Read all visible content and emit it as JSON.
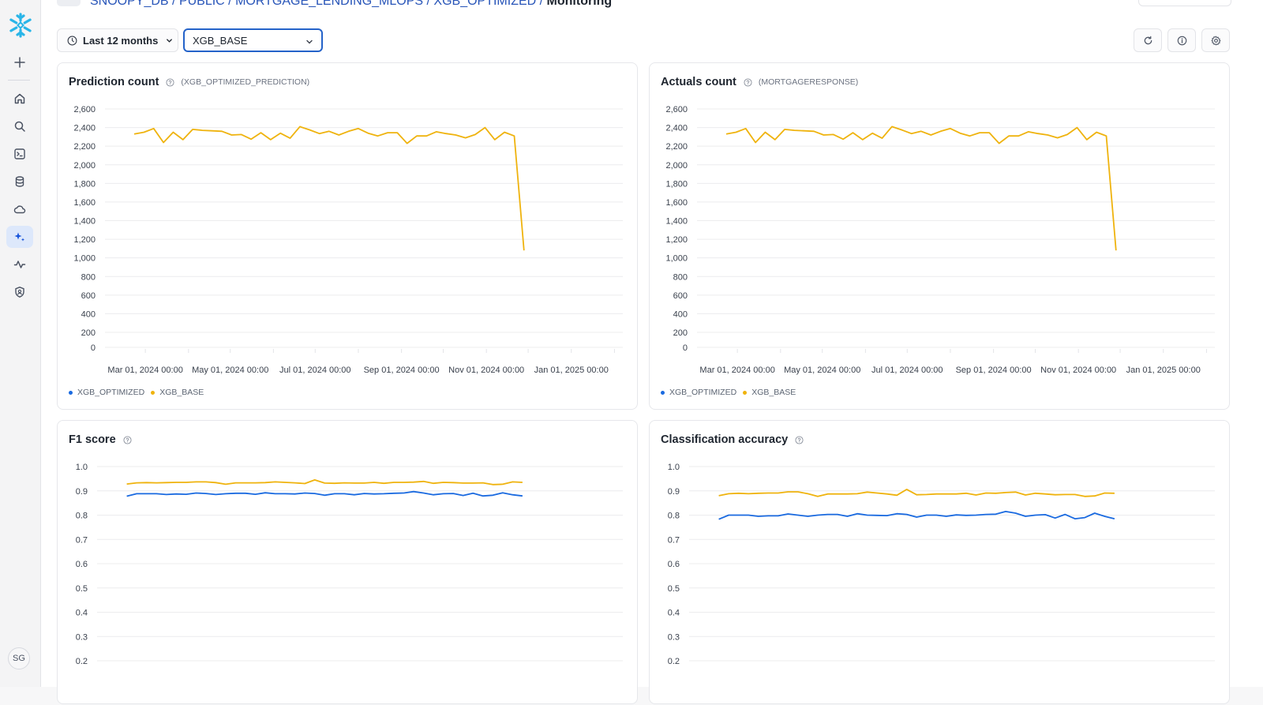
{
  "breadcrumb": {
    "items": [
      "SNOOPY_DB",
      "PUBLIC",
      "MORTGAGE_LENDING_MLOPS",
      "XGB_OPTIMIZED"
    ],
    "current": "Monitoring",
    "separator": " / "
  },
  "sidebar": {
    "items": [
      {
        "name": "create",
        "icon": "plus-icon"
      },
      {
        "name": "home",
        "icon": "home-icon"
      },
      {
        "name": "search",
        "icon": "search-icon"
      },
      {
        "name": "projects",
        "icon": "terminal-icon"
      },
      {
        "name": "data",
        "icon": "database-icon"
      },
      {
        "name": "data-products",
        "icon": "cloud-icon"
      },
      {
        "name": "ai-ml",
        "icon": "sparkle-icon",
        "active": true
      },
      {
        "name": "monitoring",
        "icon": "activity-icon"
      },
      {
        "name": "admin",
        "icon": "shield-icon"
      }
    ],
    "avatar_initials": "SG"
  },
  "toolbar": {
    "time_range_label": "Last 12 months",
    "model_select_value": "XGB_BASE",
    "refresh_icon": "refresh-icon",
    "info_icon": "info-icon",
    "settings_icon": "gear-icon"
  },
  "colors": {
    "xgb_optimized": "#1a6ae0",
    "xgb_base": "#efb30e",
    "accent": "#2563c9",
    "grid": "#ececee"
  },
  "legend": [
    {
      "name": "XGB_OPTIMIZED",
      "color": "#1a6ae0"
    },
    {
      "name": "XGB_BASE",
      "color": "#efb30e"
    }
  ],
  "chart_data": [
    {
      "id": "prediction-count",
      "type": "line",
      "title": "Prediction count",
      "subtitle": "(XGB_OPTIMIZED_PREDICTION)",
      "xlabel": "",
      "ylabel": "",
      "ylim": [
        0,
        2600
      ],
      "yticks": [
        0,
        200,
        400,
        600,
        800,
        1000,
        1200,
        1400,
        1600,
        1800,
        2000,
        2200,
        2400,
        2600
      ],
      "ytick_labels": [
        "0",
        "200",
        "400",
        "600",
        "800",
        "1,000",
        "1,200",
        "1,400",
        "1,600",
        "1,800",
        "2,000",
        "2,200",
        "2,400",
        "2,600"
      ],
      "xlim": [
        "2024-02-01",
        "2025-02-07"
      ],
      "xtick_labels": [
        "Mar 01, 2024 00:00",
        "May 01, 2024 00:00",
        "Jul 01, 2024 00:00",
        "Sep 01, 2024 00:00",
        "Nov 01, 2024 00:00",
        "Jan 01, 2025 00:00"
      ],
      "xticks": [
        "2024-03-01",
        "2024-05-01",
        "2024-07-01",
        "2024-09-01",
        "2024-11-01",
        "2025-01-01"
      ],
      "grid": true,
      "legend_placement": "bottom-left",
      "x_start": "2024-02-22",
      "x_step_days": 7,
      "series": [
        {
          "name": "XGB_OPTIMIZED",
          "values": []
        },
        {
          "name": "XGB_BASE",
          "values": [
            2330,
            2350,
            2390,
            2240,
            2350,
            2270,
            2380,
            2370,
            2365,
            2360,
            2320,
            2325,
            2275,
            2345,
            2270,
            2340,
            2285,
            2410,
            2375,
            2335,
            2360,
            2320,
            2360,
            2390,
            2340,
            2310,
            2345,
            2345,
            2230,
            2310,
            2310,
            2355,
            2335,
            2320,
            2290,
            2325,
            2400,
            2270,
            2350,
            2310,
            1080
          ]
        }
      ]
    },
    {
      "id": "actuals-count",
      "type": "line",
      "title": "Actuals count",
      "subtitle": "(MORTGAGERESPONSE)",
      "xlabel": "",
      "ylabel": "",
      "ylim": [
        0,
        2600
      ],
      "yticks": [
        0,
        200,
        400,
        600,
        800,
        1000,
        1200,
        1400,
        1600,
        1800,
        2000,
        2200,
        2400,
        2600
      ],
      "ytick_labels": [
        "0",
        "200",
        "400",
        "600",
        "800",
        "1,000",
        "1,200",
        "1,400",
        "1,600",
        "1,800",
        "2,000",
        "2,200",
        "2,400",
        "2,600"
      ],
      "xlim": [
        "2024-02-01",
        "2025-02-07"
      ],
      "xtick_labels": [
        "Mar 01, 2024 00:00",
        "May 01, 2024 00:00",
        "Jul 01, 2024 00:00",
        "Sep 01, 2024 00:00",
        "Nov 01, 2024 00:00",
        "Jan 01, 2025 00:00"
      ],
      "xticks": [
        "2024-03-01",
        "2024-05-01",
        "2024-07-01",
        "2024-09-01",
        "2024-11-01",
        "2025-01-01"
      ],
      "grid": true,
      "legend_placement": "bottom-left",
      "x_start": "2024-02-22",
      "x_step_days": 7,
      "series": [
        {
          "name": "XGB_OPTIMIZED",
          "values": []
        },
        {
          "name": "XGB_BASE",
          "values": [
            2330,
            2350,
            2390,
            2240,
            2350,
            2270,
            2380,
            2370,
            2365,
            2360,
            2320,
            2325,
            2275,
            2345,
            2270,
            2340,
            2285,
            2410,
            2375,
            2335,
            2360,
            2320,
            2360,
            2390,
            2340,
            2310,
            2345,
            2345,
            2230,
            2310,
            2310,
            2355,
            2335,
            2320,
            2290,
            2325,
            2400,
            2270,
            2350,
            2310,
            1080
          ]
        }
      ]
    },
    {
      "id": "f1-score",
      "type": "line",
      "title": "F1 score",
      "subtitle": "",
      "xlabel": "",
      "ylabel": "",
      "ylim": [
        0.2,
        1.0
      ],
      "yticks": [
        0.2,
        0.3,
        0.4,
        0.5,
        0.6,
        0.7,
        0.8,
        0.9,
        1.0
      ],
      "ytick_labels": [
        "0.2",
        "0.3",
        "0.4",
        "0.5",
        "0.6",
        "0.7",
        "0.8",
        "0.9",
        "1.0"
      ],
      "xlim": [
        "2024-02-01",
        "2025-02-07"
      ],
      "grid": true,
      "x_start": "2024-02-22",
      "x_step_days": 7,
      "series": [
        {
          "name": "XGB_OPTIMIZED",
          "values": [
            0.878,
            0.888,
            0.888,
            0.888,
            0.885,
            0.887,
            0.886,
            0.891,
            0.889,
            0.885,
            0.888,
            0.89,
            0.89,
            0.886,
            0.892,
            0.888,
            0.888,
            0.887,
            0.891,
            0.889,
            0.882,
            0.888,
            0.888,
            0.884,
            0.889,
            0.887,
            0.888,
            0.89,
            0.891,
            0.897,
            0.891,
            0.884,
            0.888,
            0.889,
            0.881,
            0.89,
            0.879,
            0.882,
            0.892,
            0.884,
            0.879
          ]
        },
        {
          "name": "XGB_BASE",
          "values": [
            0.928,
            0.933,
            0.934,
            0.933,
            0.934,
            0.935,
            0.935,
            0.937,
            0.937,
            0.934,
            0.927,
            0.933,
            0.933,
            0.933,
            0.934,
            0.937,
            0.935,
            0.933,
            0.93,
            0.945,
            0.932,
            0.931,
            0.933,
            0.932,
            0.932,
            0.935,
            0.931,
            0.935,
            0.935,
            0.936,
            0.939,
            0.931,
            0.935,
            0.934,
            0.932,
            0.932,
            0.933,
            0.926,
            0.927,
            0.937,
            0.935
          ]
        }
      ]
    },
    {
      "id": "classification-accuracy",
      "type": "line",
      "title": "Classification accuracy",
      "subtitle": "",
      "xlabel": "",
      "ylabel": "",
      "ylim": [
        0.2,
        1.0
      ],
      "yticks": [
        0.2,
        0.3,
        0.4,
        0.5,
        0.6,
        0.7,
        0.8,
        0.9,
        1.0
      ],
      "ytick_labels": [
        "0.2",
        "0.3",
        "0.4",
        "0.5",
        "0.6",
        "0.7",
        "0.8",
        "0.9",
        "1.0"
      ],
      "xlim": [
        "2024-02-01",
        "2025-02-07"
      ],
      "grid": true,
      "x_start": "2024-02-22",
      "x_step_days": 7,
      "series": [
        {
          "name": "XGB_OPTIMIZED",
          "values": [
            0.783,
            0.8,
            0.8,
            0.8,
            0.795,
            0.797,
            0.797,
            0.805,
            0.8,
            0.795,
            0.8,
            0.803,
            0.803,
            0.795,
            0.806,
            0.8,
            0.799,
            0.798,
            0.806,
            0.803,
            0.792,
            0.8,
            0.8,
            0.795,
            0.801,
            0.799,
            0.8,
            0.803,
            0.804,
            0.815,
            0.808,
            0.795,
            0.8,
            0.802,
            0.788,
            0.803,
            0.785,
            0.79,
            0.808,
            0.795,
            0.785
          ]
        },
        {
          "name": "XGB_BASE",
          "values": [
            0.88,
            0.888,
            0.89,
            0.888,
            0.89,
            0.891,
            0.891,
            0.896,
            0.896,
            0.888,
            0.877,
            0.887,
            0.887,
            0.887,
            0.888,
            0.895,
            0.891,
            0.887,
            0.882,
            0.906,
            0.884,
            0.885,
            0.887,
            0.887,
            0.887,
            0.89,
            0.883,
            0.891,
            0.89,
            0.893,
            0.895,
            0.883,
            0.89,
            0.887,
            0.884,
            0.885,
            0.885,
            0.877,
            0.879,
            0.891,
            0.89
          ]
        }
      ]
    }
  ]
}
